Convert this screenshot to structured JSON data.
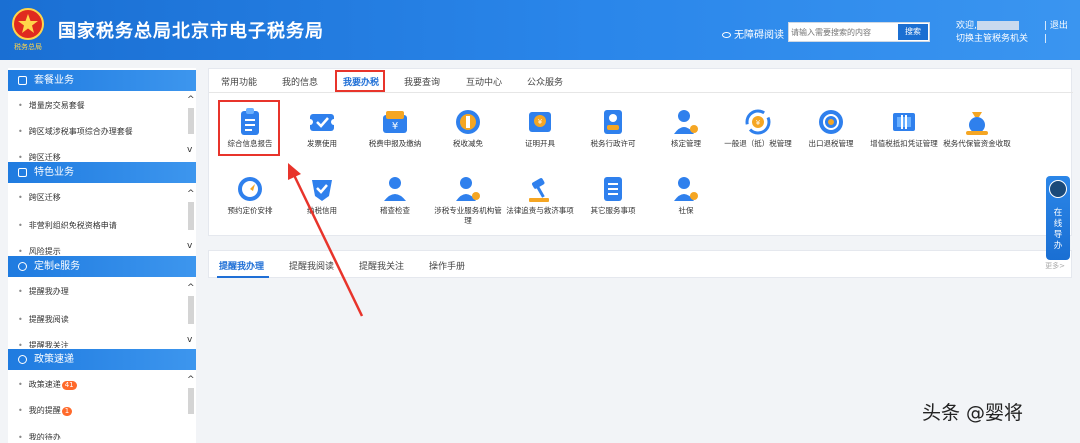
{
  "header": {
    "title": "国家税务总局北京市电子税务局",
    "logo_text": "税务总局",
    "accessibility": "无障碍阅读",
    "search_placeholder": "请输入需要搜索的内容",
    "search_button": "搜索",
    "welcome": "欢迎,",
    "switch_org": "切换主管税务机关",
    "logout": "退出"
  },
  "sidebar": {
    "groups": [
      {
        "title": "套餐业务",
        "items": [
          "增量房交易套餐",
          "跨区域涉税事项综合办理套餐",
          "跨区迁移"
        ]
      },
      {
        "title": "特色业务",
        "items": [
          "跨区迁移",
          "非营利组织免税资格申请",
          "风险提示"
        ]
      },
      {
        "title": "定制e服务",
        "items": [
          "提醒我办理",
          "提醒我阅读",
          "提醒我关注"
        ]
      },
      {
        "title": "政策速递",
        "items": [
          "政策速递",
          "我的提醒",
          "我的待办"
        ],
        "badges": [
          "41",
          "1"
        ]
      }
    ]
  },
  "tabs": [
    "常用功能",
    "我的信息",
    "我要办税",
    "我要查询",
    "互动中心",
    "公众服务"
  ],
  "active_tab": "我要办税",
  "services_row1": [
    {
      "label": "综合信息报告",
      "icon": "clipboard-icon"
    },
    {
      "label": "发票使用",
      "icon": "ticket-icon"
    },
    {
      "label": "税费申报及缴纳",
      "icon": "wallet-yuan-icon"
    },
    {
      "label": "税收减免",
      "icon": "coin-icon"
    },
    {
      "label": "证明开具",
      "icon": "certificate-icon"
    },
    {
      "label": "税务行政许可",
      "icon": "id-card-icon"
    },
    {
      "label": "核定管理",
      "icon": "person-gear-icon"
    },
    {
      "label": "一般退（抵）税管理",
      "icon": "refund-cycle-icon"
    },
    {
      "label": "出口退税管理",
      "icon": "globe-icon"
    },
    {
      "label": "增值税抵扣凭证管理",
      "icon": "invoice-stack-icon"
    },
    {
      "label": "税务代保管资金收取",
      "icon": "money-bag-icon"
    }
  ],
  "services_row2": [
    {
      "label": "预约定价安排",
      "icon": "compass-icon"
    },
    {
      "label": "纳税信用",
      "icon": "shield-check-icon"
    },
    {
      "label": "稽查检查",
      "icon": "person-icon"
    },
    {
      "label": "涉税专业服务机构管理",
      "icon": "person-gear-icon"
    },
    {
      "label": "法律追责与救济事项",
      "icon": "gavel-icon"
    },
    {
      "label": "其它服务事项",
      "icon": "document-icon"
    },
    {
      "label": "社保",
      "icon": "person-gear-icon"
    }
  ],
  "reminder_tabs": [
    "提醒我办理",
    "提醒我阅读",
    "提醒我关注",
    "操作手册"
  ],
  "more": "更多>",
  "float_nav": "在线导办",
  "watermark": "头条 @婴将"
}
